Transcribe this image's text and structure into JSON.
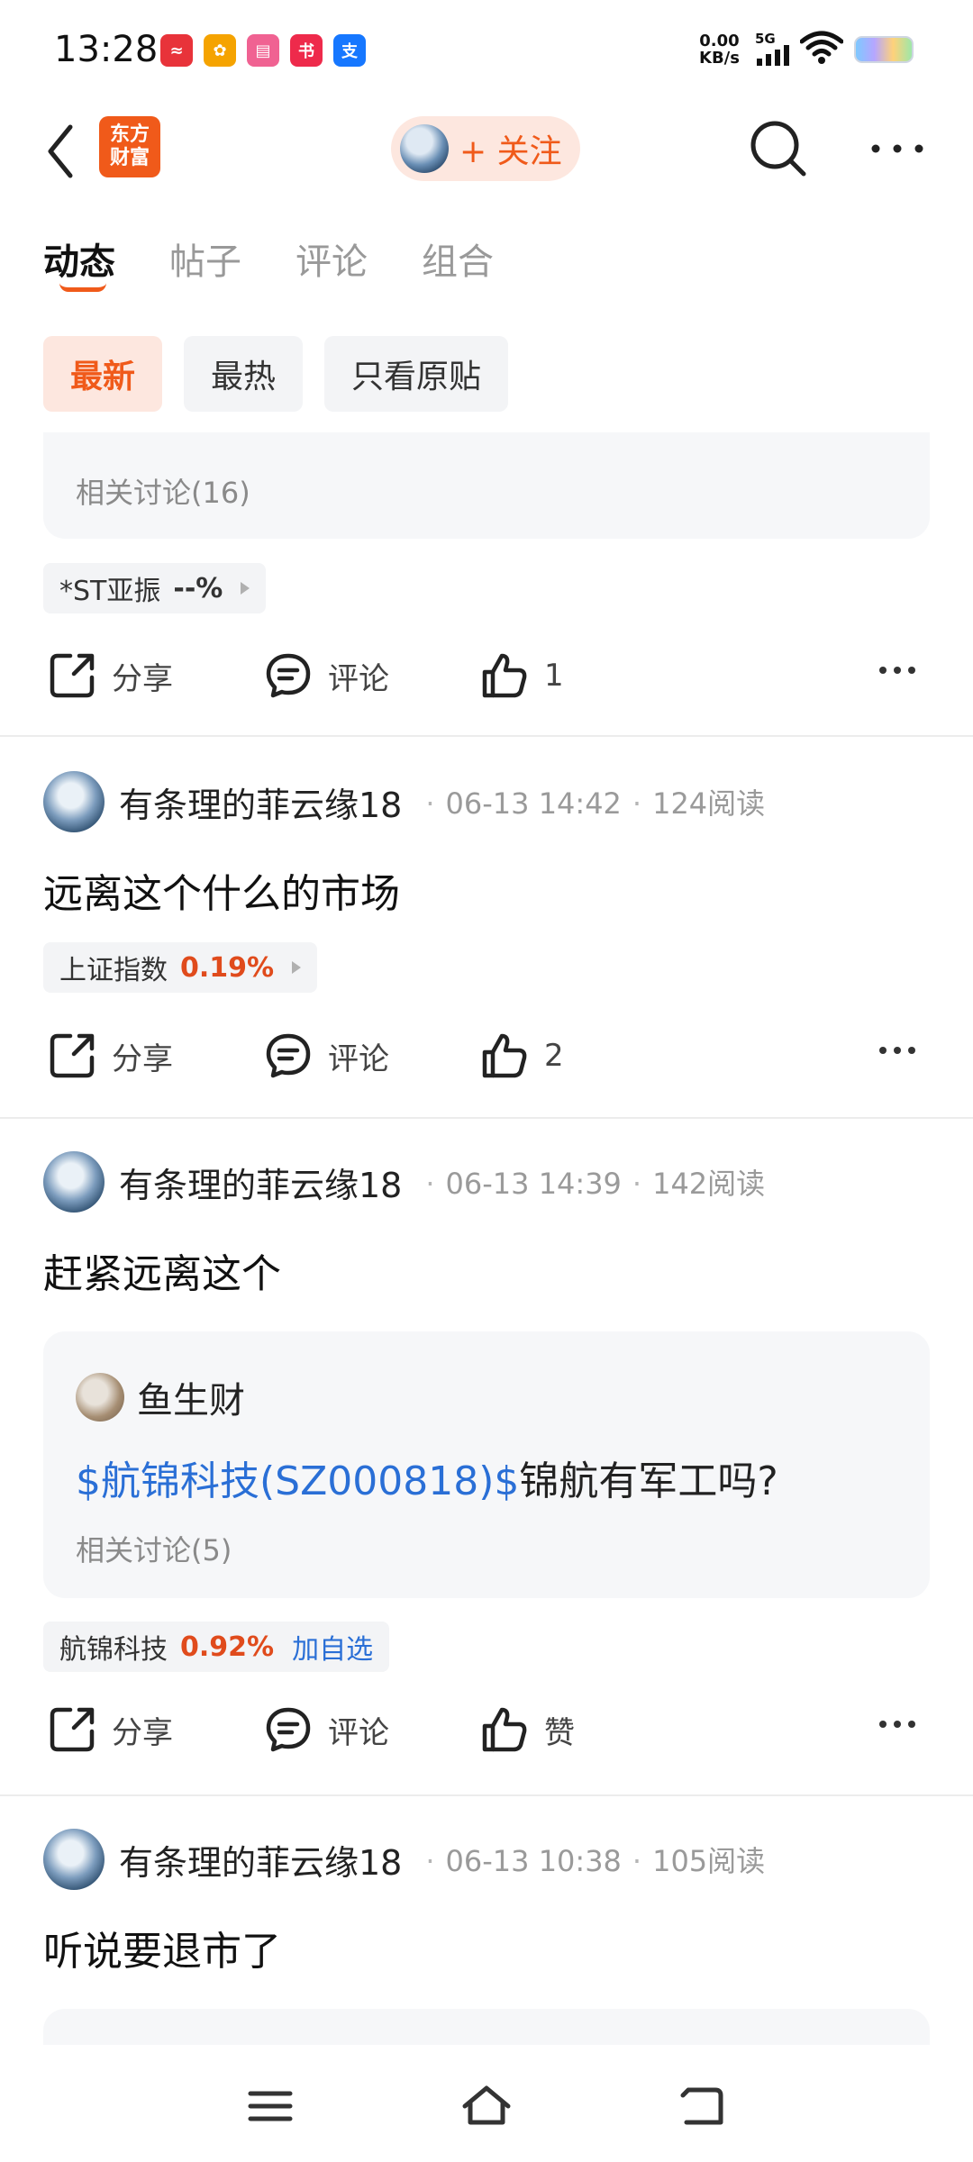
{
  "status_bar": {
    "time": "13:28",
    "net_speed_value": "0.00",
    "net_speed_unit": "KB/s",
    "network_type": "5G"
  },
  "status_apps": [
    {
      "name": "stock-app-icon",
      "color": "#e8333a",
      "glyph": "≈"
    },
    {
      "name": "plant-app-icon",
      "color": "#f5a300",
      "glyph": "✿"
    },
    {
      "name": "bilibili-app-icon",
      "color": "#f06292",
      "glyph": "▤"
    },
    {
      "name": "xiaohongshu-app-icon",
      "color": "#ee2a4b",
      "glyph": "书"
    },
    {
      "name": "alipay-app-icon",
      "color": "#1677ff",
      "glyph": "支"
    }
  ],
  "header": {
    "logo_line1": "东方",
    "logo_line2": "财富",
    "follow_label": "+ 关注"
  },
  "tabs": [
    "动态",
    "帖子",
    "评论",
    "组合"
  ],
  "filters": [
    "最新",
    "最热",
    "只看原贴"
  ],
  "feed": {
    "prev_card": {
      "related": "相关讨论(16)",
      "stock": {
        "name": "*ST亚振",
        "change": "--%"
      },
      "actions": {
        "share": "分享",
        "comment": "评论",
        "like": "1"
      }
    },
    "posts": [
      {
        "author": "有条理的菲云缘18",
        "time": "06-13 14:42",
        "reads": "124阅读",
        "text": "远离这个什么的市场",
        "stock": {
          "name": "上证指数",
          "change": "0.19%"
        },
        "actions": {
          "share": "分享",
          "comment": "评论",
          "like": "2"
        }
      },
      {
        "author": "有条理的菲云缘18",
        "time": "06-13 14:39",
        "reads": "142阅读",
        "text": "赶紧远离这个",
        "quote": {
          "author": "鱼生财",
          "link": "$航锦科技(SZ000818)$",
          "text": "锦航有军工吗?",
          "related": "相关讨论(5)"
        },
        "stock": {
          "name": "航锦科技",
          "change": "0.92%",
          "add": "加自选"
        },
        "actions": {
          "share": "分享",
          "comment": "评论",
          "like": "赞"
        }
      },
      {
        "author": "有条理的菲云缘18",
        "time": "06-13 10:38",
        "reads": "105阅读",
        "text": "听说要退市了"
      }
    ]
  },
  "colors": {
    "accent": "#f05a1a",
    "link": "#2a6fd6",
    "rise": "#e04b1c"
  }
}
